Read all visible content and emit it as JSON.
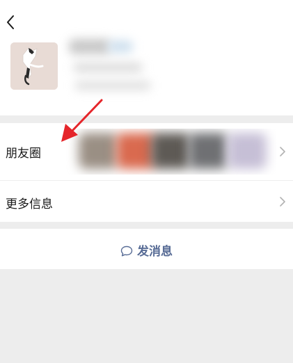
{
  "header": {
    "back_icon": "chevron-left-icon"
  },
  "profile": {
    "avatar_icon": "cat-photo-avatar"
  },
  "rows": {
    "moments": {
      "label": "朋友圈",
      "icon": "chevron-right-icon"
    },
    "more_info": {
      "label": "更多信息",
      "icon": "chevron-right-icon"
    }
  },
  "actions": {
    "send_message": {
      "label": "发消息",
      "icon": "chat-bubble-icon"
    }
  },
  "colors": {
    "background": "#ededed",
    "card": "#ffffff",
    "text": "#191919",
    "link": "#576b95",
    "annotation_arrow": "#e5252a"
  }
}
